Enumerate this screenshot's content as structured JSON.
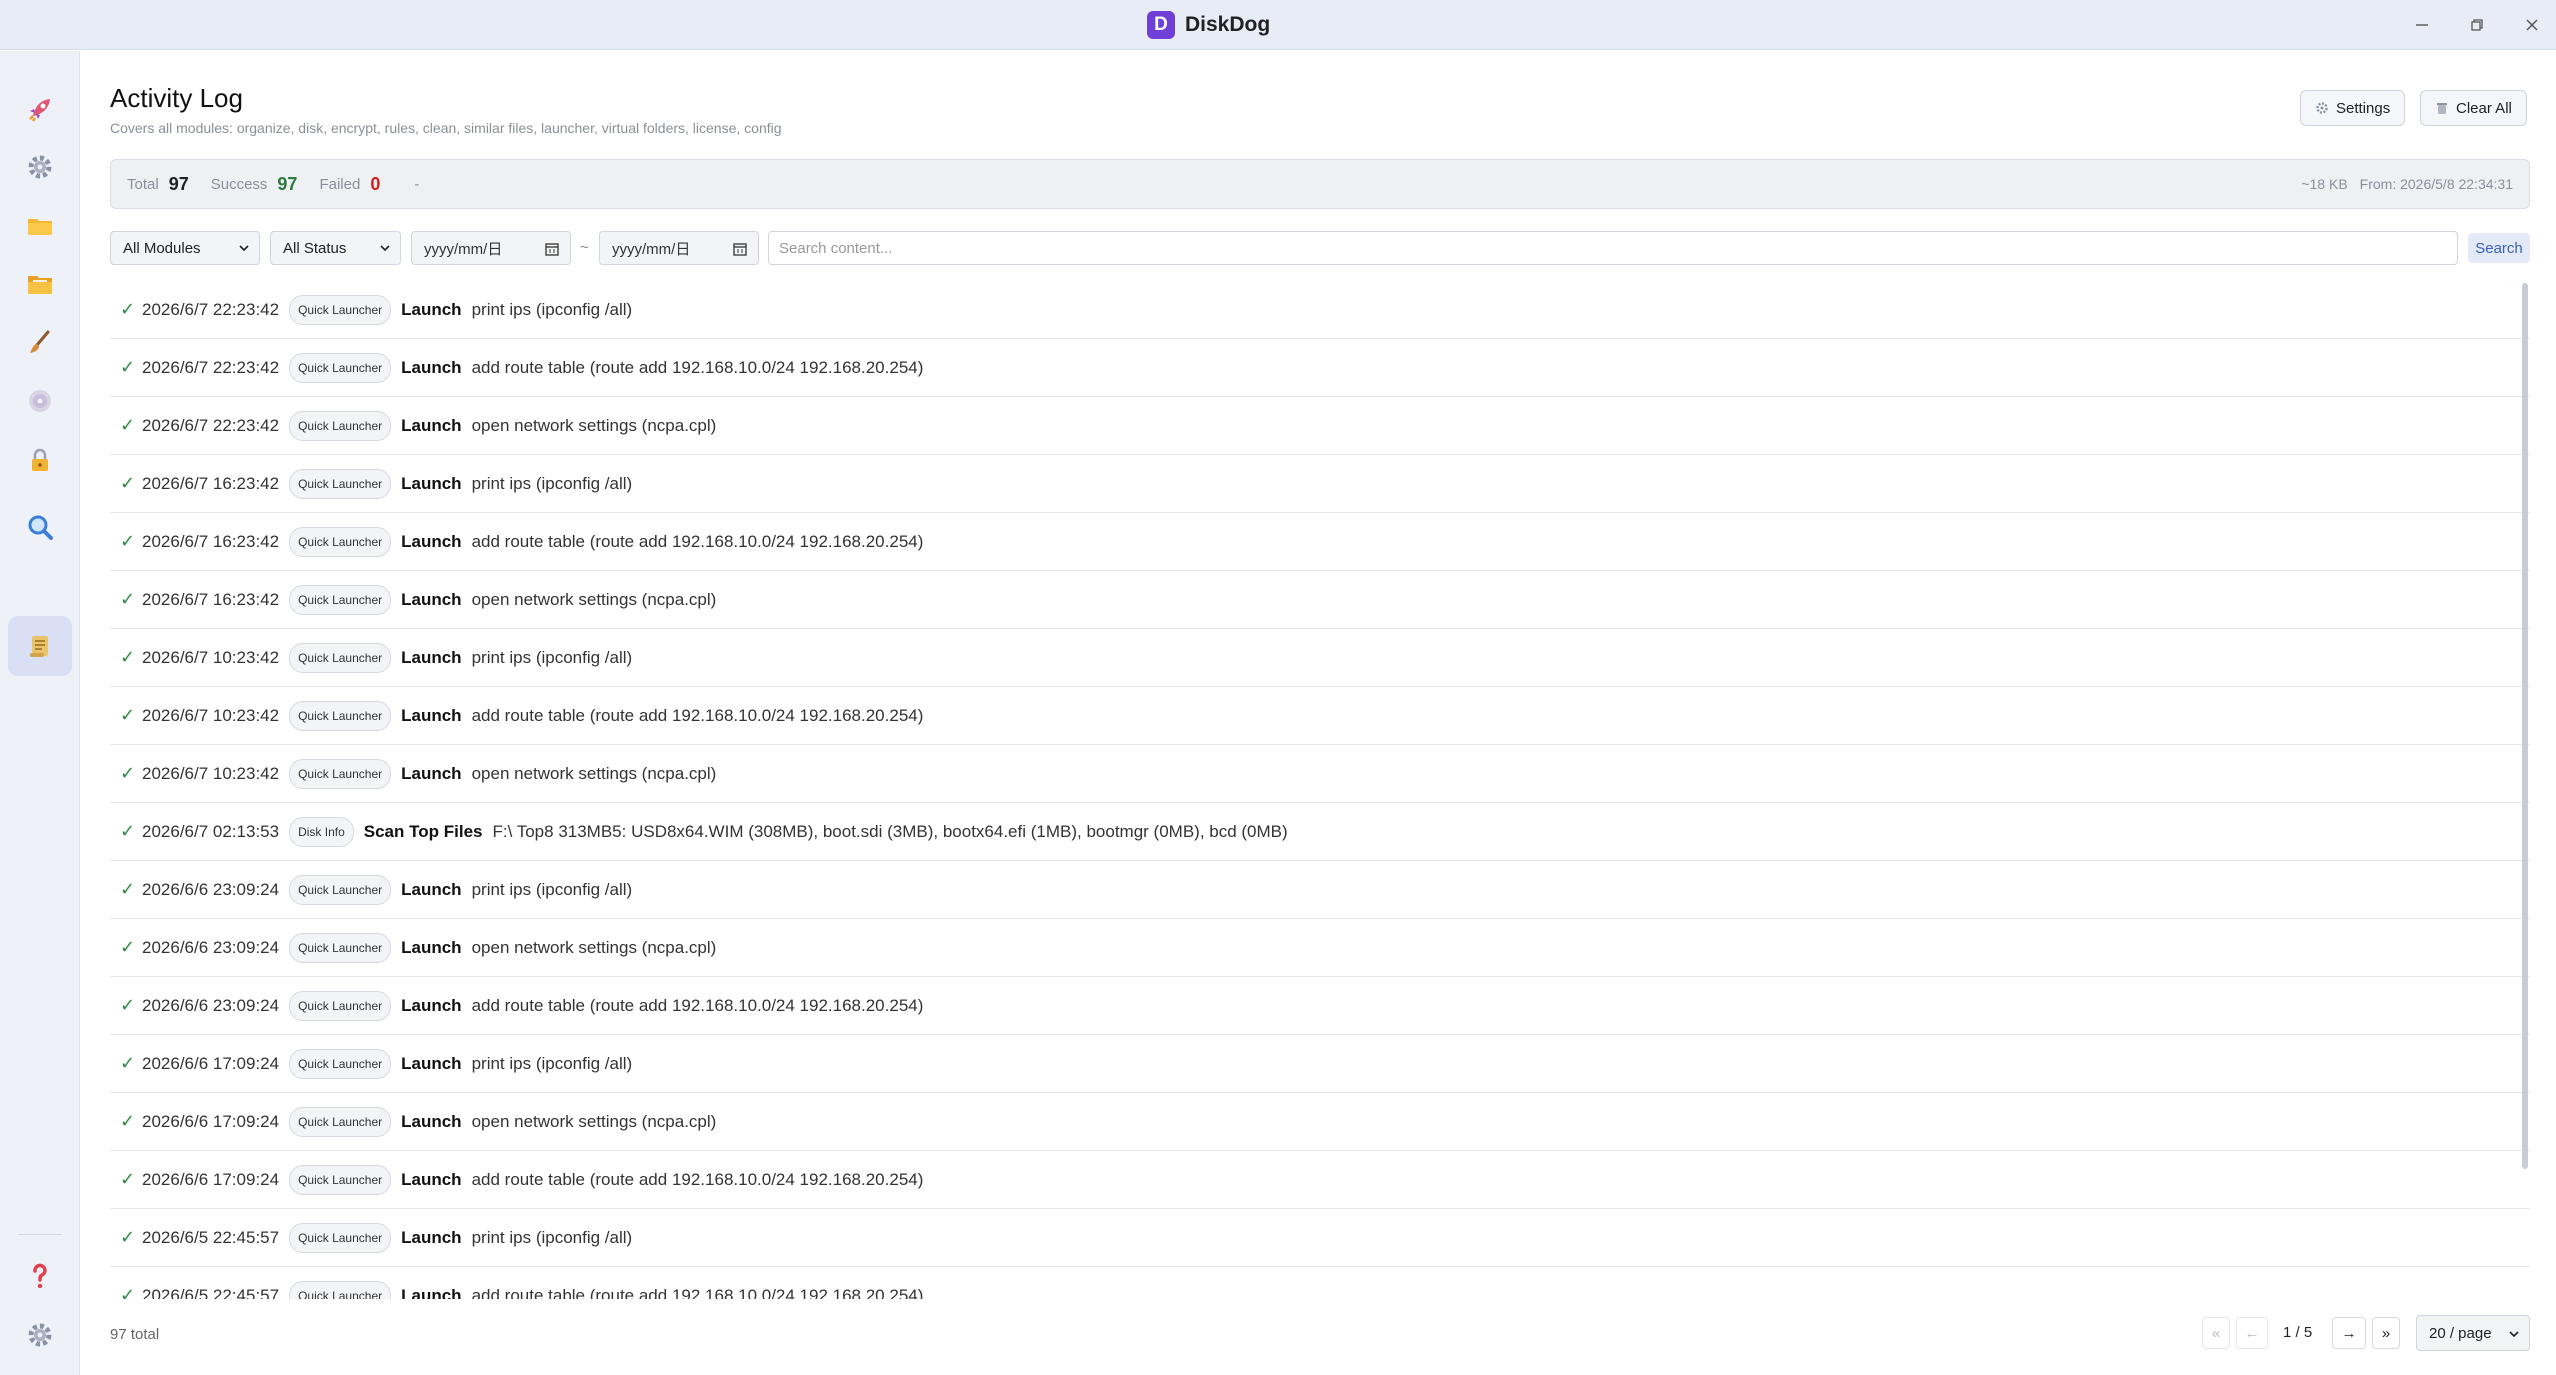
{
  "window": {
    "title": "DiskDog",
    "logo_letter": "D"
  },
  "sidebar": {
    "items": [
      {
        "icon": "rocket-icon"
      },
      {
        "icon": "gear-icon"
      },
      {
        "icon": "folder-icon"
      },
      {
        "icon": "folder-files-icon"
      },
      {
        "icon": "brush-icon"
      },
      {
        "icon": "disc-icon"
      },
      {
        "icon": "lock-icon"
      },
      {
        "icon": "magnifier-icon"
      },
      {
        "icon": "scroll-icon",
        "active": true
      }
    ],
    "bottom": [
      {
        "icon": "help-icon"
      },
      {
        "icon": "settings-gear-icon"
      }
    ]
  },
  "header": {
    "title": "Activity Log",
    "subtitle": "Covers all modules: organize, disk, encrypt, rules, clean, similar files, launcher, virtual folders, license, config",
    "settings_label": "Settings",
    "clear_label": "Clear All"
  },
  "stats": {
    "total_label": "Total",
    "total": "97",
    "success_label": "Success",
    "success": "97",
    "failed_label": "Failed",
    "failed": "0",
    "dash": "-",
    "size": "~18 KB",
    "from": "From: 2026/5/8 22:34:31"
  },
  "filters": {
    "module": "All Modules",
    "status": "All Status",
    "date_from": "yyyy/mm/日",
    "range_sep": "~",
    "date_to": "yyyy/mm/日",
    "search_placeholder": "Search content...",
    "search_label": "Search"
  },
  "log": [
    {
      "time": "2026/6/7 22:23:42",
      "tag": "Quick Launcher",
      "action": "Launch",
      "detail": "print ips (ipconfig /all)"
    },
    {
      "time": "2026/6/7 22:23:42",
      "tag": "Quick Launcher",
      "action": "Launch",
      "detail": "add route table (route add 192.168.10.0/24 192.168.20.254)"
    },
    {
      "time": "2026/6/7 22:23:42",
      "tag": "Quick Launcher",
      "action": "Launch",
      "detail": "open network settings (ncpa.cpl)"
    },
    {
      "time": "2026/6/7 16:23:42",
      "tag": "Quick Launcher",
      "action": "Launch",
      "detail": "print ips (ipconfig /all)"
    },
    {
      "time": "2026/6/7 16:23:42",
      "tag": "Quick Launcher",
      "action": "Launch",
      "detail": "add route table (route add 192.168.10.0/24 192.168.20.254)"
    },
    {
      "time": "2026/6/7 16:23:42",
      "tag": "Quick Launcher",
      "action": "Launch",
      "detail": "open network settings (ncpa.cpl)"
    },
    {
      "time": "2026/6/7 10:23:42",
      "tag": "Quick Launcher",
      "action": "Launch",
      "detail": "print ips (ipconfig /all)"
    },
    {
      "time": "2026/6/7 10:23:42",
      "tag": "Quick Launcher",
      "action": "Launch",
      "detail": "add route table (route add 192.168.10.0/24 192.168.20.254)"
    },
    {
      "time": "2026/6/7 10:23:42",
      "tag": "Quick Launcher",
      "action": "Launch",
      "detail": "open network settings (ncpa.cpl)"
    },
    {
      "time": "2026/6/7 02:13:53",
      "tag": "Disk Info",
      "action": "Scan Top Files",
      "detail": "F:\\ Top8 313MB5: USD8x64.WIM (308MB), boot.sdi (3MB), bootx64.efi (1MB), bootmgr (0MB), bcd (0MB)"
    },
    {
      "time": "2026/6/6 23:09:24",
      "tag": "Quick Launcher",
      "action": "Launch",
      "detail": "print ips (ipconfig /all)"
    },
    {
      "time": "2026/6/6 23:09:24",
      "tag": "Quick Launcher",
      "action": "Launch",
      "detail": "open network settings (ncpa.cpl)"
    },
    {
      "time": "2026/6/6 23:09:24",
      "tag": "Quick Launcher",
      "action": "Launch",
      "detail": "add route table (route add 192.168.10.0/24 192.168.20.254)"
    },
    {
      "time": "2026/6/6 17:09:24",
      "tag": "Quick Launcher",
      "action": "Launch",
      "detail": "print ips (ipconfig /all)"
    },
    {
      "time": "2026/6/6 17:09:24",
      "tag": "Quick Launcher",
      "action": "Launch",
      "detail": "open network settings (ncpa.cpl)"
    },
    {
      "time": "2026/6/6 17:09:24",
      "tag": "Quick Launcher",
      "action": "Launch",
      "detail": "add route table (route add 192.168.10.0/24 192.168.20.254)"
    },
    {
      "time": "2026/6/5 22:45:57",
      "tag": "Quick Launcher",
      "action": "Launch",
      "detail": "print ips (ipconfig /all)"
    },
    {
      "time": "2026/6/5 22:45:57",
      "tag": "Quick Launcher",
      "action": "Launch",
      "detail": "add route table (route add 192.168.10.0/24 192.168.20.254)"
    }
  ],
  "footer": {
    "total_text": "97 total",
    "first": "«",
    "prev": "←",
    "page_info": "1 / 5",
    "next": "→",
    "last": "»",
    "page_size": "20 / page"
  },
  "colors": {
    "accent": "#6f3fd6",
    "success": "#2e8a46",
    "failed": "#d02020",
    "sidebar_bg": "#eef1f8"
  }
}
